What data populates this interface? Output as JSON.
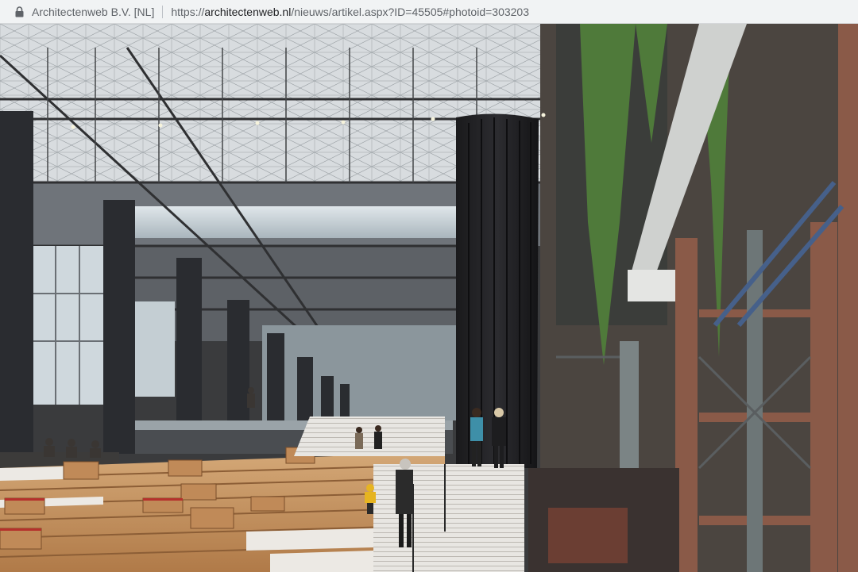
{
  "browser": {
    "site_identity": "Architectenweb B.V. [NL]",
    "url_scheme": "https://",
    "url_host": "architectenweb.nl",
    "url_path": "/nieuws/artikel.aspx?ID=45505#photoid=303203"
  },
  "photo": {
    "icon": "lock-icon"
  }
}
